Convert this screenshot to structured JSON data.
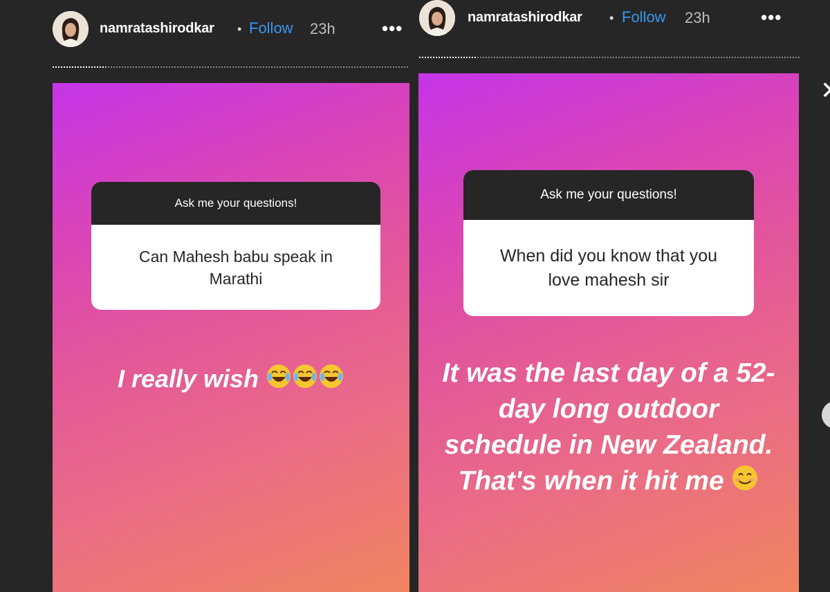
{
  "left_story": {
    "username": "namratashirodkar",
    "separator": "•",
    "follow_label": "Follow",
    "time": "23h",
    "more_label": "•••",
    "progress": 0.15,
    "question_prompt": "Ask me your questions!",
    "question_text": "Can Mahesh babu speak in Marathi",
    "answer_text": "I really wish",
    "answer_emojis": [
      "tears-of-joy-icon",
      "tears-of-joy-icon",
      "tears-of-joy-icon"
    ]
  },
  "right_story": {
    "username": "namratashirodkar",
    "separator": "•",
    "follow_label": "Follow",
    "time": "23h",
    "more_label": "•••",
    "progress": 0.15,
    "question_prompt": "Ask me your questions!",
    "question_text": "When did you know that you love mahesh sir",
    "answer_text": "It was the last day of a 52-day long outdoor schedule in New Zealand. That's when it hit me",
    "answer_emoji": "smiling-face-icon"
  },
  "controls": {
    "close_label": "✕",
    "close_icon": "close-icon",
    "next_icon": "next-story-button"
  },
  "colors": {
    "gradient_top": "#c535e8",
    "gradient_bottom": "#f08460",
    "follow_blue": "#3897f0",
    "background": "#262626"
  }
}
